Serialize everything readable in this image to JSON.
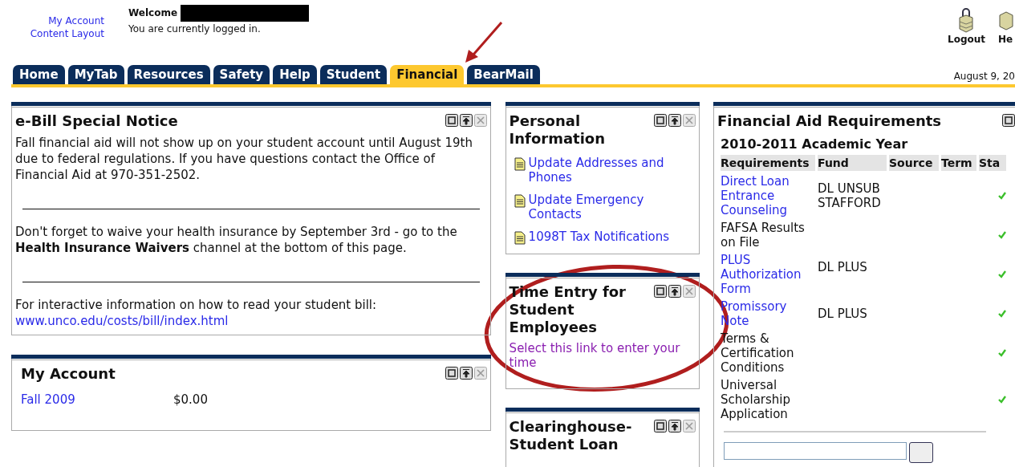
{
  "header": {
    "links": [
      "My Account",
      "Content Layout"
    ],
    "welcome": "Welcome",
    "status": "You are currently logged in.",
    "actions": [
      {
        "label": "Logout",
        "kind": "lock"
      },
      {
        "label": "He",
        "kind": "help"
      }
    ]
  },
  "tabs": [
    {
      "label": "Home",
      "selected": false
    },
    {
      "label": "MyTab",
      "selected": false
    },
    {
      "label": "Resources",
      "selected": false
    },
    {
      "label": "Safety",
      "selected": false
    },
    {
      "label": "Help",
      "selected": false
    },
    {
      "label": "Student",
      "selected": false
    },
    {
      "label": "Financial",
      "selected": true
    },
    {
      "label": "BearMail",
      "selected": false
    }
  ],
  "date": "August 9, 20",
  "ebill": {
    "title": "e-Bill Special Notice",
    "paragraphs": [
      "Fall financial aid will not show up on your student account until August 19th due to federal regulations. If you have questions contact the Office of Financial Aid at 970-351-2502.",
      "Don't forget to waive your health insurance by September 3rd - go to the **Health Insurance Waivers** channel at the bottom of this page."
    ],
    "link_intro": "For interactive information on how to read your student bill: ",
    "link": "www.unco.edu/costs/bill/index.html"
  },
  "my_account": {
    "title": "My Account",
    "rows": [
      {
        "term": "Fall 2009",
        "amount": "$0.00"
      }
    ]
  },
  "personal": {
    "title": "Personal Information",
    "links": [
      "Update Addresses and Phones",
      "Update Emergency Contacts",
      "1098T Tax Notifications"
    ]
  },
  "time_entry": {
    "title": "Time Entry for Student Employees",
    "link": "Select this link to enter your time"
  },
  "clearinghouse": {
    "title": "Clearinghouse-Student Loan"
  },
  "aid": {
    "title": "Financial Aid Requirements",
    "year": "2010-2011 Academic Year",
    "columns": [
      "Requirements",
      "Fund",
      "Source",
      "Term",
      "Sta"
    ],
    "rows": [
      {
        "requirement": "Direct Loan Entrance Counseling",
        "kind": "link",
        "fund": "DL UNSUB STAFFORD",
        "satisfied": true
      },
      {
        "requirement": "FAFSA Results on File",
        "kind": "text",
        "fund": "",
        "satisfied": true
      },
      {
        "requirement": "PLUS Authorization Form",
        "kind": "link",
        "fund": "DL PLUS",
        "satisfied": true
      },
      {
        "requirement": "Promissory Note",
        "kind": "link",
        "fund": "DL PLUS",
        "satisfied": true
      },
      {
        "requirement": "Terms & Certification Conditions",
        "kind": "text",
        "fund": "",
        "satisfied": true
      },
      {
        "requirement": "Universal Scholarship Application",
        "kind": "text",
        "fund": "",
        "satisfied": true
      }
    ]
  }
}
